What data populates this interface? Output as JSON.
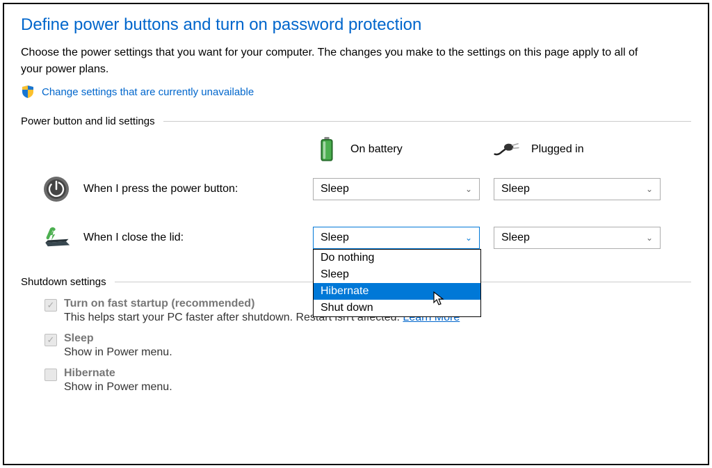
{
  "title": "Define power buttons and turn on password protection",
  "description": "Choose the power settings that you want for your computer. The changes you make to the settings on this page apply to all of your power plans.",
  "change_link": "Change settings that are currently unavailable",
  "section1": {
    "label": "Power button and lid settings",
    "col_battery": "On battery",
    "col_plugged": "Plugged in",
    "rows": {
      "power_button": {
        "label": "When I press the power button:",
        "battery_value": "Sleep",
        "plugged_value": "Sleep"
      },
      "close_lid": {
        "label": "When I close the lid:",
        "battery_value": "Sleep",
        "plugged_value": "Sleep"
      }
    },
    "dropdown_options": [
      "Do nothing",
      "Sleep",
      "Hibernate",
      "Shut down"
    ],
    "dropdown_highlighted": "Hibernate"
  },
  "section2": {
    "label": "Shutdown settings",
    "items": [
      {
        "title": "Turn on fast startup (recommended)",
        "desc_pre": "This helps start your PC faster after shutdown. Restart isn't affected. ",
        "learn_more": "Learn More",
        "checked": true
      },
      {
        "title": "Sleep",
        "desc_pre": "Show in Power menu.",
        "learn_more": "",
        "checked": true
      },
      {
        "title": "Hibernate",
        "desc_pre": "Show in Power menu.",
        "learn_more": "",
        "checked": false
      }
    ]
  }
}
